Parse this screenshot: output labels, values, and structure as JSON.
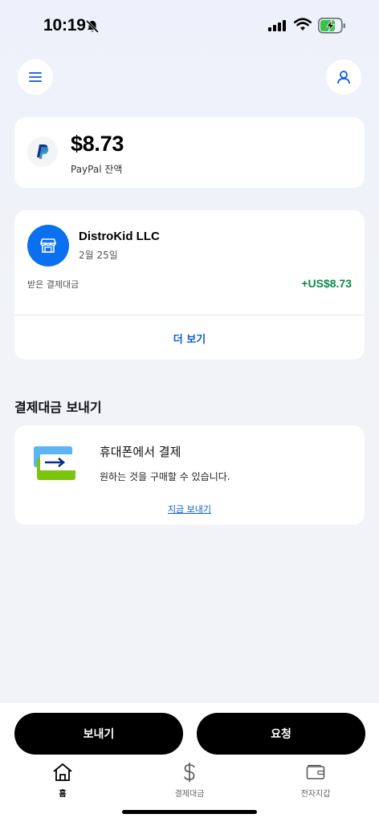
{
  "status_bar": {
    "time": "10:19"
  },
  "balance": {
    "amount": "$8.73",
    "label": "PayPal 잔액"
  },
  "activity": {
    "merchant": "DistroKid LLC",
    "date": "2월 25일",
    "type": "받은 결제대금",
    "amount": "+US$8.73",
    "see_more": "더 보기"
  },
  "send_section": {
    "title": "결제대금 보내기",
    "card_title": "휴대폰에서 결제",
    "card_desc": "원하는 것을 구매할 수 있습니다.",
    "card_link": "지금 보내기"
  },
  "actions": {
    "send": "보내기",
    "request": "요청"
  },
  "nav": {
    "home": "홈",
    "payments": "결제대금",
    "wallet": "전자지갑"
  },
  "colors": {
    "accent": "#0a6ff0",
    "positive": "#0a8a4a",
    "link": "#0a5cd6"
  }
}
